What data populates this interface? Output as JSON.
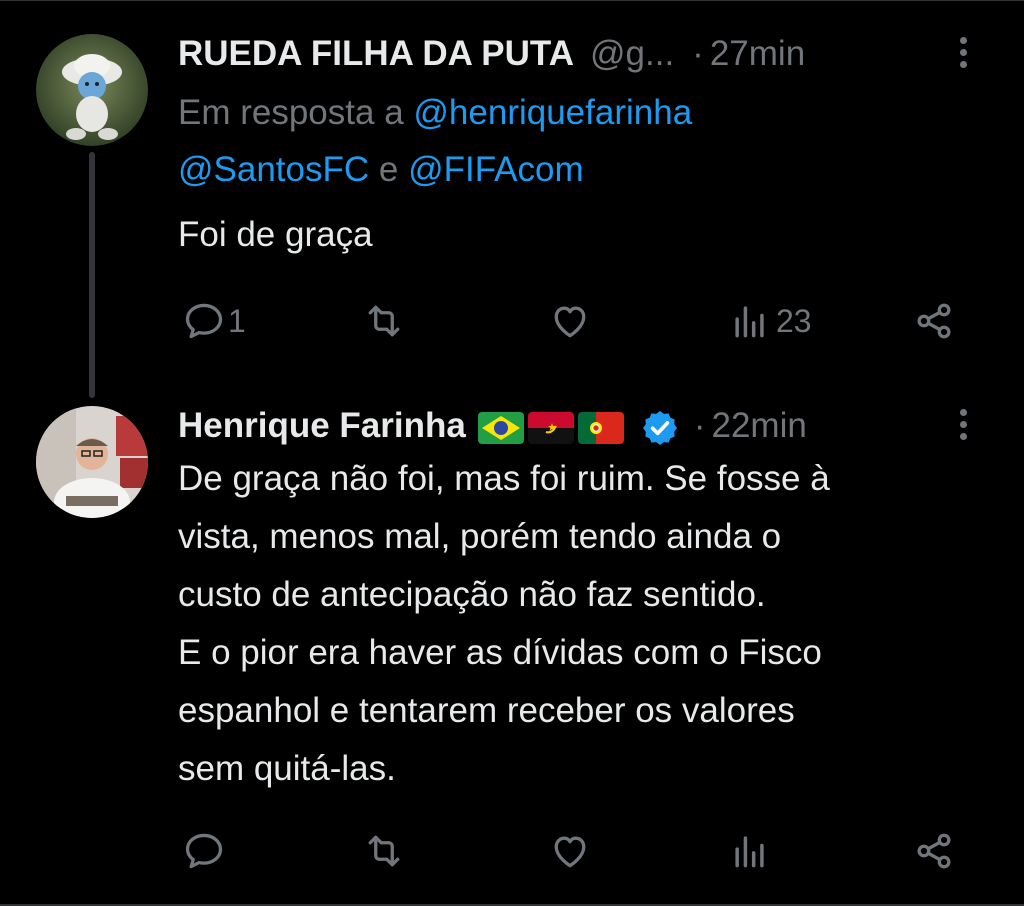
{
  "tweets": [
    {
      "name": "RUEDA FILHA DA PUTA",
      "handle": "@g...",
      "separator": "·",
      "time": "27min",
      "reply_prefix": "Em resposta a",
      "reply_mentions": [
        "@henriquefarinha",
        "@SantosFC",
        "@FIFAcom"
      ],
      "reply_conjunction": "e",
      "text": "Foi de graça",
      "reply_count": "1",
      "views": "23"
    },
    {
      "name": "Henrique Farinha",
      "flags": [
        "brazil-flag",
        "angola-flag",
        "portugal-flag"
      ],
      "verified": true,
      "separator": "·",
      "time": "22min",
      "text_lines": [
        "De graça não foi, mas foi ruim. Se fosse à",
        "vista, menos mal, porém tendo ainda o",
        "custo de antecipação não faz sentido.",
        "E o pior era haver as dívidas com o Fisco",
        "espanhol e tentarem receber os valores",
        "sem quitá-las."
      ],
      "reply_count": "",
      "views": ""
    }
  ],
  "colors": {
    "background": "#000000",
    "text": "#e7e9ea",
    "muted": "#71767b",
    "link": "#1d9bf0",
    "divider": "#2f3336"
  },
  "icons": [
    "reply-icon",
    "retweet-icon",
    "like-icon",
    "views-icon",
    "share-icon",
    "more-icon",
    "verified-badge-icon"
  ]
}
